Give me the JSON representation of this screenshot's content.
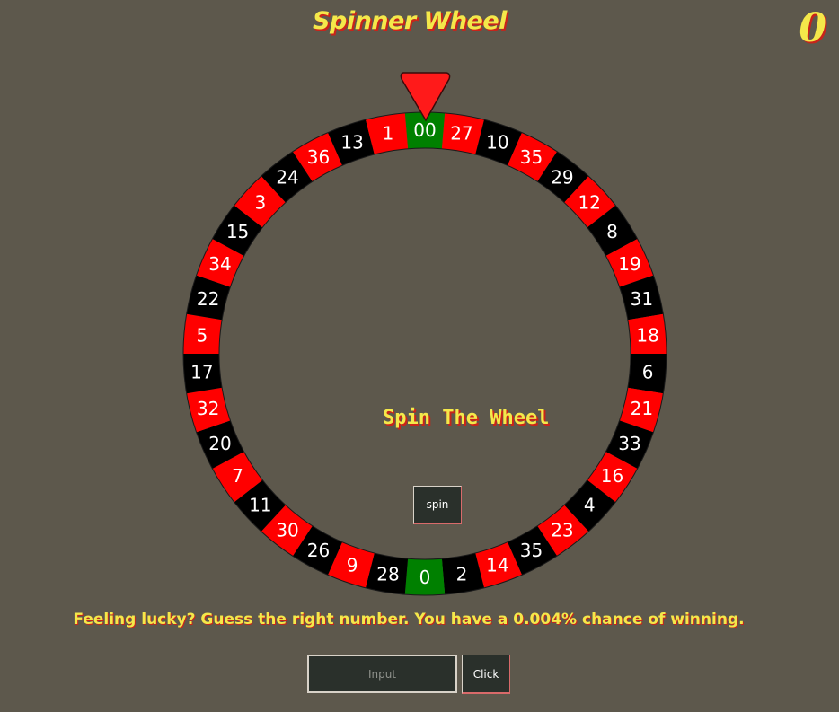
{
  "header": {
    "title": "Spinner Wheel",
    "score": "0"
  },
  "wheel": {
    "pockets": [
      {
        "label": "00",
        "color": "green"
      },
      {
        "label": "27",
        "color": "red"
      },
      {
        "label": "10",
        "color": "black"
      },
      {
        "label": "35",
        "color": "red"
      },
      {
        "label": "29",
        "color": "black"
      },
      {
        "label": "12",
        "color": "red"
      },
      {
        "label": "8",
        "color": "black"
      },
      {
        "label": "19",
        "color": "red"
      },
      {
        "label": "31",
        "color": "black"
      },
      {
        "label": "18",
        "color": "red"
      },
      {
        "label": "6",
        "color": "black"
      },
      {
        "label": "21",
        "color": "red"
      },
      {
        "label": "33",
        "color": "black"
      },
      {
        "label": "16",
        "color": "red"
      },
      {
        "label": "4",
        "color": "black"
      },
      {
        "label": "23",
        "color": "red"
      },
      {
        "label": "35",
        "color": "black"
      },
      {
        "label": "14",
        "color": "red"
      },
      {
        "label": "2",
        "color": "black"
      },
      {
        "label": "0",
        "color": "green"
      },
      {
        "label": "28",
        "color": "black"
      },
      {
        "label": "9",
        "color": "red"
      },
      {
        "label": "26",
        "color": "black"
      },
      {
        "label": "30",
        "color": "red"
      },
      {
        "label": "11",
        "color": "black"
      },
      {
        "label": "7",
        "color": "red"
      },
      {
        "label": "20",
        "color": "black"
      },
      {
        "label": "32",
        "color": "red"
      },
      {
        "label": "17",
        "color": "black"
      },
      {
        "label": "5",
        "color": "red"
      },
      {
        "label": "22",
        "color": "black"
      },
      {
        "label": "34",
        "color": "red"
      },
      {
        "label": "15",
        "color": "black"
      },
      {
        "label": "3",
        "color": "red"
      },
      {
        "label": "24",
        "color": "black"
      },
      {
        "label": "36",
        "color": "red"
      },
      {
        "label": "13",
        "color": "black"
      },
      {
        "label": "1",
        "color": "red"
      }
    ],
    "colors": {
      "red": "#ff0000",
      "black": "#000000",
      "green": "#008000",
      "pointer": "#ff1a1a"
    },
    "center_text": "Spin The Wheel",
    "spin_label": "spin"
  },
  "game": {
    "message": "Feeling lucky? Guess the right number. You have a 0.004% chance of winning.",
    "input_placeholder": "Input",
    "input_value": "",
    "click_label": "Click"
  },
  "icons": {
    "pointer": "triangle-pointer-icon"
  }
}
